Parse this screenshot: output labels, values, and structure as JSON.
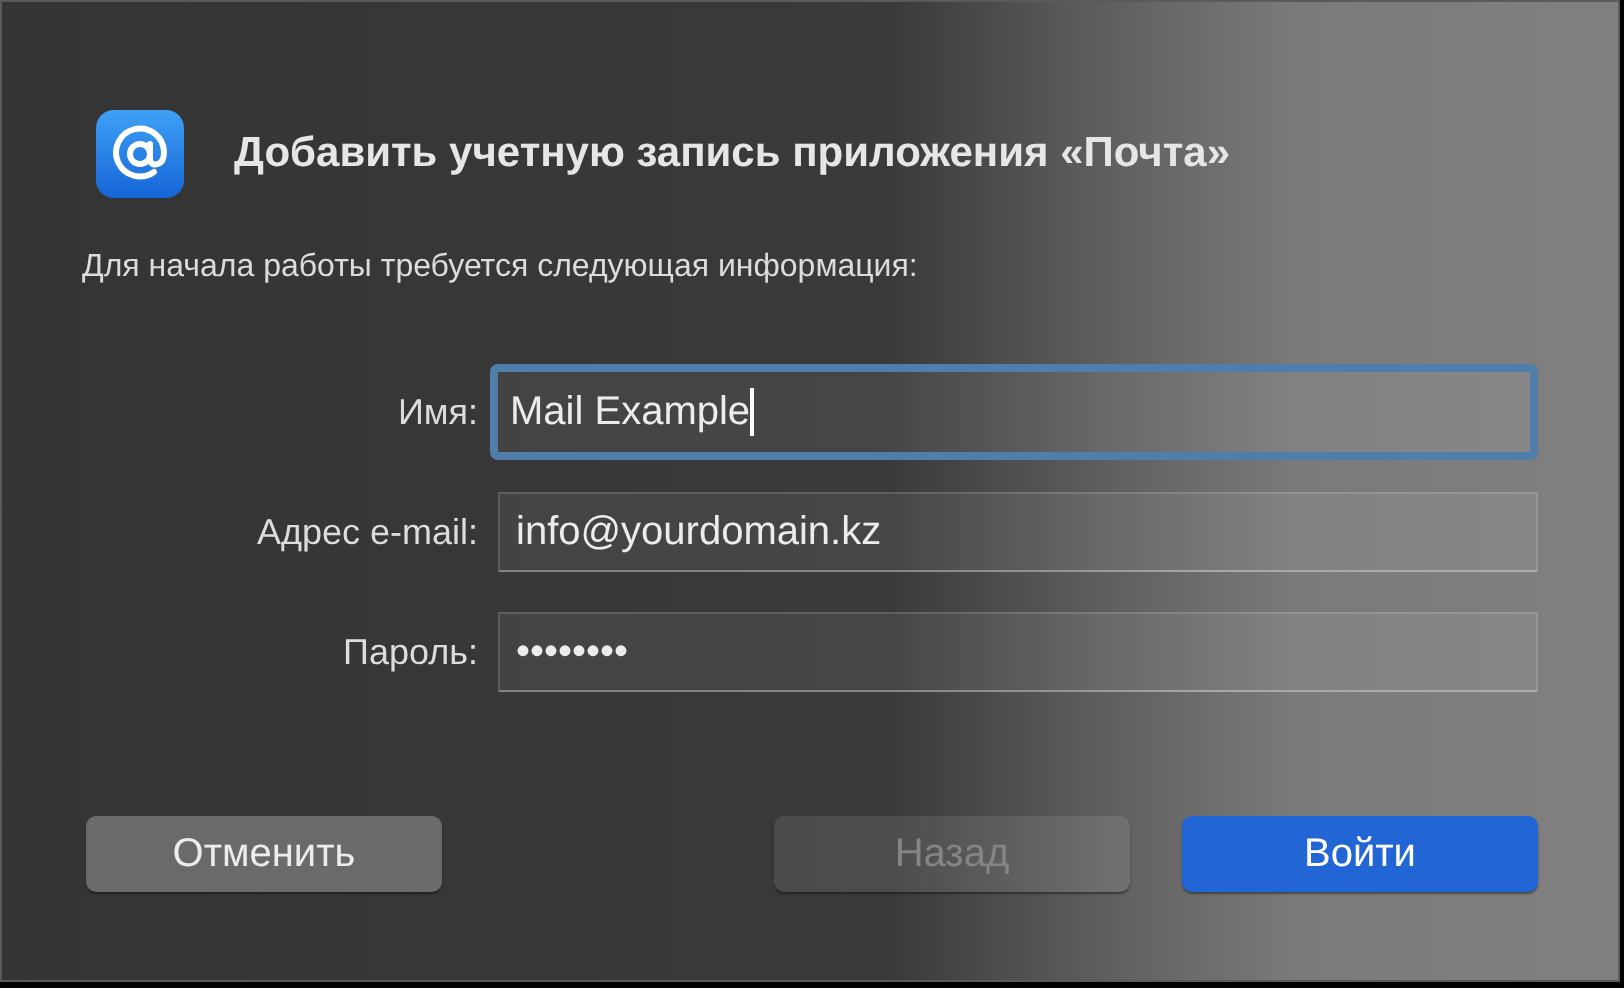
{
  "dialog": {
    "title": "Добавить учетную запись приложения «Почта»",
    "intro": "Для начала работы требуется следующая информация:",
    "fields": [
      {
        "label": "Имя:",
        "value": "Mail Example",
        "focused": true
      },
      {
        "label": "Адрес e-mail:",
        "value": "info@yourdomain.kz",
        "focused": false
      },
      {
        "label": "Пароль:",
        "value": "••••••••",
        "focused": false
      }
    ],
    "buttons": [
      {
        "label": "Отменить",
        "kind": "default",
        "disabled": false
      },
      {
        "label": "Назад",
        "kind": "default",
        "disabled": true
      },
      {
        "label": "Войти",
        "kind": "primary",
        "disabled": false
      }
    ]
  }
}
